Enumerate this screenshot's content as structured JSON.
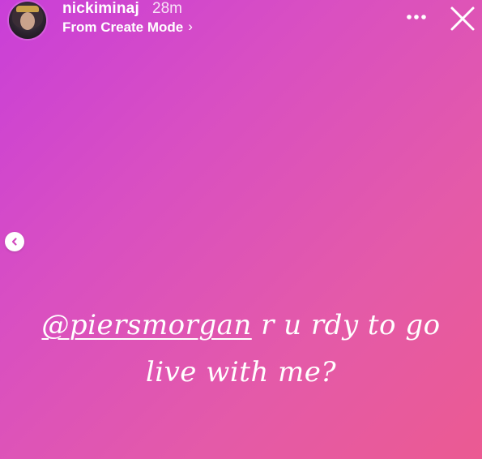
{
  "header": {
    "username": "nickiminaj",
    "time_ago": "28m",
    "subtitle": "From Create Mode",
    "subtitle_chevron": "›"
  },
  "icons": {
    "more": "more-horizontal-icon",
    "close": "close-icon",
    "previous": "chevron-left-icon"
  },
  "story": {
    "mention": "@piersmorgan",
    "line1_rest": " r u rdy to go",
    "line2": "live with me?"
  },
  "colors": {
    "gradient_start": "#c93fd8",
    "gradient_end": "#eb5a92",
    "text": "#ffffff"
  }
}
